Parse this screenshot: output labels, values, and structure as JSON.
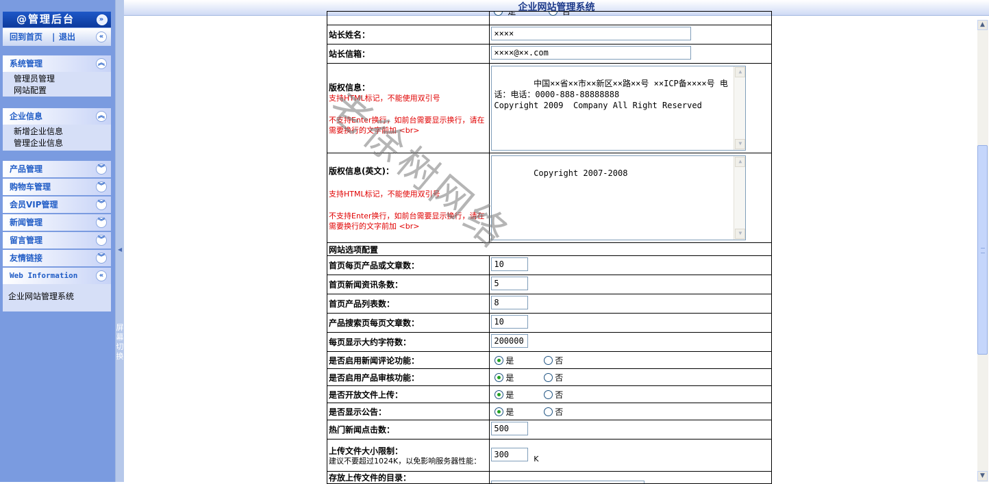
{
  "sidebar": {
    "header": "@管理后台",
    "home_link": "回到首页",
    "separator": "|",
    "logout_link": "退出",
    "groups": [
      {
        "title": "系统管理",
        "items": [
          "管理员管理",
          "网站配置"
        ]
      },
      {
        "title": "企业信息",
        "items": [
          "新增企业信息",
          "管理企业信息"
        ]
      },
      {
        "title": "产品管理"
      },
      {
        "title": "购物车管理"
      },
      {
        "title": "会员VIP管理"
      },
      {
        "title": "新闻管理"
      },
      {
        "title": "留言管理"
      },
      {
        "title": "友情链接"
      },
      {
        "title": "Web Information",
        "items": [
          "企业网站管理系统"
        ]
      }
    ]
  },
  "splitter": {
    "label": "屏幕切换"
  },
  "header": {
    "title": "企业网站管理系统"
  },
  "watermark": "老徐树网络",
  "form": {
    "top_partial": {
      "yes": "是",
      "no": "否"
    },
    "webmaster_name": {
      "label": "站长姓名：",
      "value": "××××"
    },
    "webmaster_email": {
      "label": "站长信箱：",
      "value": "××××@××.com"
    },
    "copyright": {
      "label": "版权信息：",
      "note1": "支持HTML标记，不能使用双引号",
      "note2": "不支持Enter换行，如前台需要显示换行，请在需要换行的文字前加 <br>",
      "value": "中国××省××市××新区××路××号 ××ICP备××××号 电话：电话：0000-888-88888888\nCopyright 2009  Company All Right Reserved"
    },
    "copyright_en": {
      "label": "版权信息(英文)：",
      "note1": "支持HTML标记，不能使用双引号",
      "note2": "不支持Enter换行，如前台需要显示换行，请在需要换行的文字前加 <br>",
      "value": "Copyright 2007-2008"
    },
    "section_title": "网站选项配置",
    "fields": [
      {
        "label": "首页每页产品或文章数：",
        "value": "10"
      },
      {
        "label": "首页新闻资讯条数：",
        "value": "5"
      },
      {
        "label": "首页产品列表数：",
        "value": "8"
      },
      {
        "label": "产品搜索页每页文章数：",
        "value": "10"
      },
      {
        "label": "每页显示大约字符数：",
        "value": "200000"
      }
    ],
    "radios": [
      {
        "label": "是否启用新闻评论功能：",
        "yes": "是",
        "no": "否",
        "selected": "是"
      },
      {
        "label": "是否启用产品审核功能：",
        "yes": "是",
        "no": "否",
        "selected": "是"
      },
      {
        "label": "是否开放文件上传：",
        "yes": "是",
        "no": "否",
        "selected": "是"
      },
      {
        "label": "是否显示公告：",
        "yes": "是",
        "no": "否",
        "selected": "是"
      }
    ],
    "hot_clicks": {
      "label": "热门新闻点击数：",
      "value": "500"
    },
    "upload_limit": {
      "label": "上传文件大小限制：",
      "hint": "建议不要超过1024K，以免影响服务器性能：",
      "value": "300",
      "unit": "K"
    },
    "upload_dir": {
      "label": "存放上传文件的目录："
    }
  },
  "colors": {
    "sidebar_bg": "#7a9be0",
    "accent": "#215dc6",
    "note_red": "#e00000"
  }
}
